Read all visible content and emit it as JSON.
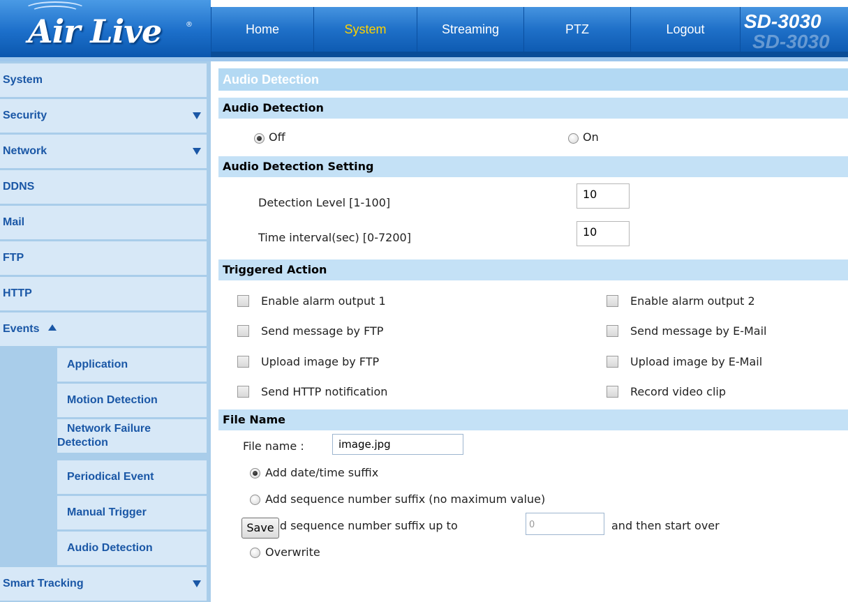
{
  "header": {
    "logo_text": "Air Live",
    "logo_reg": "®",
    "model": "SD-3030",
    "nav": [
      "Home",
      "System",
      "Streaming",
      "PTZ",
      "Logout"
    ],
    "active_nav": "System"
  },
  "sidebar": {
    "items": [
      {
        "label": "System",
        "arrow": "none"
      },
      {
        "label": "Security",
        "arrow": "down"
      },
      {
        "label": "Network",
        "arrow": "down"
      },
      {
        "label": "DDNS",
        "arrow": "none"
      },
      {
        "label": "Mail",
        "arrow": "none"
      },
      {
        "label": "FTP",
        "arrow": "none"
      },
      {
        "label": "HTTP",
        "arrow": "none"
      },
      {
        "label": "Events",
        "arrow": "up"
      }
    ],
    "sub_items": [
      {
        "label": "Application"
      },
      {
        "label": "Motion Detection"
      },
      {
        "label": "Network Failure",
        "label2": "Detection"
      },
      {
        "label": "Periodical Event"
      },
      {
        "label": "Manual Trigger"
      },
      {
        "label": "Audio Detection"
      }
    ],
    "bottom_item": {
      "label": "Smart Tracking",
      "arrow": "down"
    }
  },
  "main": {
    "page_title": "Audio Detection",
    "sections": {
      "audio_detection": "Audio Detection",
      "setting": "Audio Detection Setting",
      "triggered": "Triggered Action",
      "file_name": "File Name"
    },
    "detection_mode": {
      "off_label": "Off",
      "on_label": "On",
      "selected": "Off"
    },
    "settings": {
      "level_label": "Detection Level [1-100]",
      "level_value": "10",
      "interval_label": "Time interval(sec) [0-7200]",
      "interval_value": "10"
    },
    "triggered_actions": [
      {
        "label": "Enable alarm output 1",
        "checked": false
      },
      {
        "label": "Enable alarm output 2",
        "checked": false
      },
      {
        "label": "Send message by FTP",
        "checked": false
      },
      {
        "label": "Send message by E-Mail",
        "checked": false
      },
      {
        "label": "Upload image by FTP",
        "checked": false
      },
      {
        "label": "Upload image by E-Mail",
        "checked": false
      },
      {
        "label": "Send HTTP notification",
        "checked": false
      },
      {
        "label": "Record video clip",
        "checked": false
      }
    ],
    "file": {
      "file_name_label": "File name :",
      "file_name_value": "image.jpg",
      "options": [
        {
          "label": "Add date/time suffix",
          "checked": true
        },
        {
          "label": "Add sequence number suffix (no maximum value)",
          "checked": false
        },
        {
          "label": "Add sequence number suffix up to",
          "checked": false
        },
        {
          "label": "Overwrite",
          "checked": false
        }
      ],
      "seq_max_placeholder": "0",
      "seq_after_label": "and then start over"
    },
    "save_label": "Save"
  },
  "colors": {
    "header_blue": "#1b6dc6",
    "active_nav": "#ffd200",
    "sidebar_text": "#1a57a6",
    "sidebar_bg": "#a9cdea",
    "sidebar_item_bg": "#d7e8f7",
    "section_bg": "#c4e1f6",
    "title_bg": "#b3d9f3"
  }
}
